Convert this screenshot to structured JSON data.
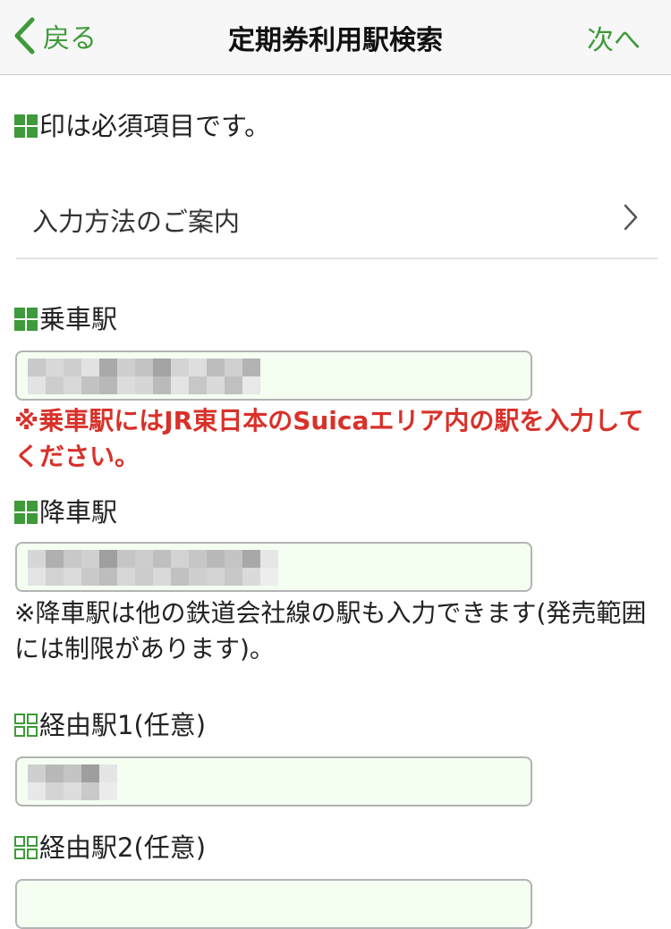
{
  "nav": {
    "back_label": "戻る",
    "title": "定期券利用駅検索",
    "next_label": "次へ"
  },
  "required_note": "印は必須項目です。",
  "guide_link": "入力方法のご案内",
  "fields": {
    "boarding": {
      "label": "乗車駅",
      "note": "※乗車駅にはJR東日本のSuicaエリア内の駅を入力してください。"
    },
    "alighting": {
      "label": "降車駅",
      "note": "※降車駅は他の鉄道会社線の駅も入力できます(発売範囲には制限があります)。"
    },
    "via1": {
      "label": "経由駅1(任意)"
    },
    "via2": {
      "label": "経由駅2(任意)"
    }
  },
  "colors": {
    "accent_green": "#3e9a3a",
    "required_mark": "#3e9a3a",
    "error_red": "#d8312a",
    "input_bg": "#f4fff1"
  },
  "icons": {
    "back": "chevron-left-icon",
    "guide": "chevron-right-icon",
    "required": "filled-grid-icon",
    "optional": "outline-grid-icon"
  }
}
